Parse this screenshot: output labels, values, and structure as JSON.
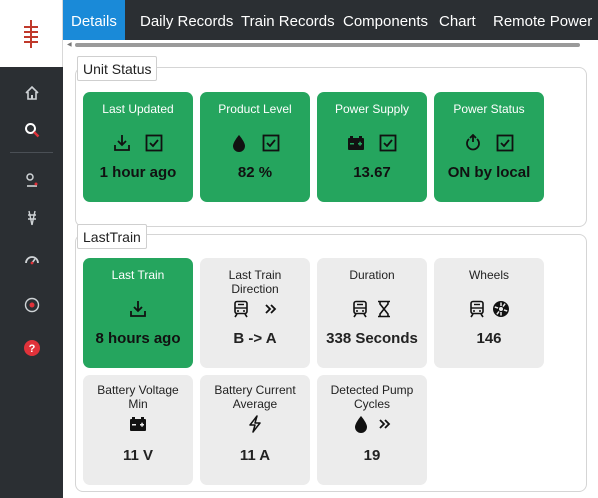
{
  "tabs": [
    "Details",
    "Daily Records",
    "Train Records",
    "Components",
    "Chart",
    "Remote Power"
  ],
  "active_tab": "Details",
  "unit_status": {
    "title": "Unit Status",
    "cards": [
      {
        "title": "Last Updated",
        "icons": [
          "download-icon",
          "checkbox-icon"
        ],
        "value": "1 hour ago"
      },
      {
        "title": "Product Level",
        "icons": [
          "drop-icon",
          "checkbox-icon"
        ],
        "value": "82 %"
      },
      {
        "title": "Power Supply",
        "icons": [
          "battery-icon",
          "checkbox-icon"
        ],
        "value": "13.67"
      },
      {
        "title": "Power Status",
        "icons": [
          "power-cycle-icon",
          "checkbox-icon"
        ],
        "value": "ON by local"
      }
    ]
  },
  "last_train": {
    "title": "LastTrain",
    "cards": [
      {
        "title": "Last Train",
        "icons": [
          "download-icon"
        ],
        "value": "8 hours ago"
      },
      {
        "title": "Last Train Direction",
        "icons": [
          "train-icon",
          "double-chevron-icon"
        ],
        "value": "B -> A"
      },
      {
        "title": "Duration",
        "icons": [
          "train-icon",
          "hourglass-icon"
        ],
        "value": "338 Seconds"
      },
      {
        "title": "Wheels",
        "icons": [
          "train-icon",
          "wheel-icon"
        ],
        "value": "146"
      },
      {
        "title": "Battery Voltage Min",
        "icons": [
          "battery-icon"
        ],
        "value": "11 V"
      },
      {
        "title": "Battery Current Average",
        "icons": [
          "bolt-icon"
        ],
        "value": "11 A"
      },
      {
        "title": "Detected Pump Cycles",
        "icons": [
          "drop-icon",
          "double-chevron-icon"
        ],
        "value": "19"
      }
    ]
  },
  "sidebar_icons": [
    "home-icon",
    "search-icon",
    "route-icon",
    "track-icon",
    "gauge-icon",
    "power-icon",
    "help-icon"
  ],
  "colors": {
    "green": "#25a55e",
    "tab_active": "#1a8ad8",
    "sidebar": "#2b2f33",
    "help": "#e0323a",
    "card_gray": "#ececec"
  }
}
